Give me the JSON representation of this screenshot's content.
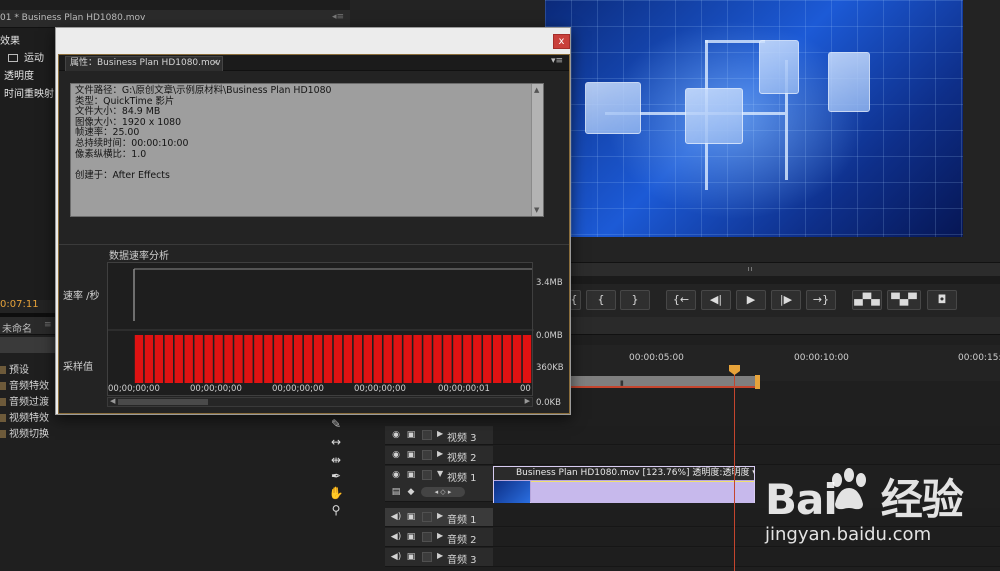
{
  "colors": {
    "accent": "#e7a33a",
    "playhead": "#c4452e",
    "bar": "#e01212",
    "clip": "#b7a6dc",
    "close": "#c9403b"
  },
  "effects_panel": {
    "title": "01 * Business Plan HD1080.mov",
    "label": "效果",
    "motion": "运动",
    "opacity": "透明度",
    "time_remap": "时间重映射"
  },
  "left_timecode": "0:07:11",
  "project_panel": {
    "tab": "未命名",
    "items": [
      "预设",
      "音频特效",
      "音频过渡",
      "视频特效",
      "视频切换"
    ]
  },
  "dialog": {
    "tab_title": "属性：Business Plan HD1080.mov",
    "close": "x",
    "menu": "▾≡",
    "info_text": "文件路径：G:\\原创文章\\示例原材料\\Business Plan HD1080\n类型：QuickTime 影片\n文件大小：84.9 MB\n图像大小：1920 x 1080\n帧速率：25.00\n总持续时间：00:00:10:00\n像素纵横比：1.0\n\n创建于：After Effects",
    "chart_title": "数据速率分析",
    "y_label_rate": "速率 /秒",
    "y_label_sample": "采样值"
  },
  "chart_data": {
    "type": "bar",
    "title": "数据速率分析",
    "ylabel_top": "速率 /秒",
    "ylabel_bottom": "采样值",
    "rate_axis_ticks": [
      "3.4MB",
      "0.0MB"
    ],
    "sample_axis_ticks": [
      "360KB",
      "0.0KB"
    ],
    "x_tick_labels": [
      "00;00;00;00",
      "00;00;00;00",
      "00;00;00;00",
      "00;00;00;00",
      "00;00;00;01",
      "00"
    ],
    "sample_values_kb": [
      360,
      360,
      360,
      360,
      360,
      360,
      360,
      360,
      360,
      360,
      360,
      360,
      360,
      360,
      360,
      360,
      360,
      360,
      360,
      360,
      360,
      360,
      360,
      360,
      360,
      360,
      360,
      360,
      360,
      360,
      360,
      360,
      360,
      360,
      360,
      360,
      360,
      360,
      360,
      360
    ],
    "rate_spike_mb": 3.4,
    "rate_line_mb": 3.4,
    "ylim_sample_kb": [
      0,
      360
    ],
    "grid": false
  },
  "transport_buttons": [
    "{",
    "}",
    "{←",
    "◀|",
    "▶",
    "|▶",
    "→}",
    "lift",
    "extract",
    "camera"
  ],
  "timeline": {
    "times": [
      "00:00:05:00",
      "00:00:10:00",
      "00:00:15:"
    ],
    "tracks": [
      {
        "label": "视频 3"
      },
      {
        "label": "视频 2"
      },
      {
        "label": "视频 1"
      },
      {
        "label": "音频 1"
      },
      {
        "label": "音频 2"
      },
      {
        "label": "音频 3"
      }
    ],
    "clip_title": "Business Plan HD1080.mov [123.76%]  透明度:透明度 ▾"
  },
  "watermark": {
    "logo_left": "Bai",
    "logo_right": "经验",
    "url": "jingyan.baidu.com"
  }
}
